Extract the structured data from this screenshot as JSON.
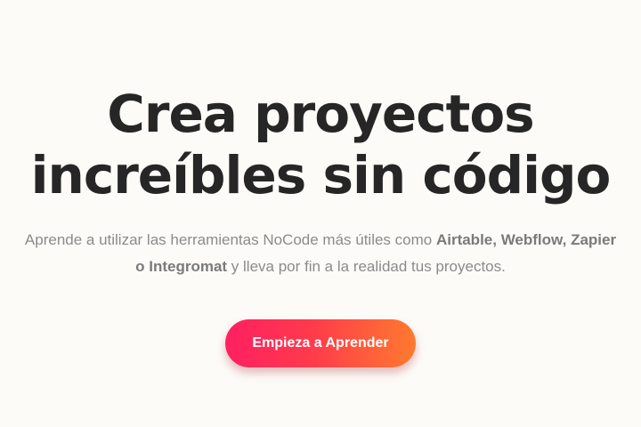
{
  "hero": {
    "headline_line1": "Crea proyectos",
    "headline_line2": "increíbles sin código",
    "subtitle": {
      "intro": "Aprende a utilizar las herramientas NoCode más útiles como ",
      "tools_part1": "Airtable, Webflow, Zapier",
      "tools_part2": "o Integromat",
      "outro": " y lleva por fin a la realidad tus proyectos."
    },
    "cta_label": "Empieza a Aprender",
    "cta_gradient": [
      "#ff1f62",
      "#ff3a4c",
      "#ff7a2e"
    ]
  }
}
